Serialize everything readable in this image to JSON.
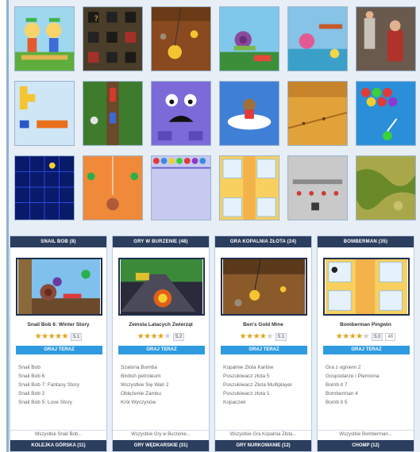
{
  "thumbnails": [
    {
      "name": "thumb-game-1",
      "icon": "two-kids-game"
    },
    {
      "name": "thumb-game-2",
      "icon": "dark-maze-game"
    },
    {
      "name": "thumb-game-3",
      "icon": "gold-mine-game"
    },
    {
      "name": "thumb-game-4",
      "icon": "snail-level-game"
    },
    {
      "name": "thumb-game-5",
      "icon": "snail-dream-game"
    },
    {
      "name": "thumb-game-6",
      "icon": "street-fight-game"
    },
    {
      "name": "thumb-game-7",
      "icon": "tetris-blocks-game"
    },
    {
      "name": "thumb-game-8",
      "icon": "train-track-game"
    },
    {
      "name": "thumb-game-9",
      "icon": "purple-face-game"
    },
    {
      "name": "thumb-game-10",
      "icon": "cloud-rider-game"
    },
    {
      "name": "thumb-game-11",
      "icon": "golden-field-game"
    },
    {
      "name": "thumb-game-12",
      "icon": "bubble-shooter-game"
    },
    {
      "name": "thumb-game-13",
      "icon": "blue-grid-game"
    },
    {
      "name": "thumb-game-14",
      "icon": "orange-sky-game"
    },
    {
      "name": "thumb-game-15",
      "icon": "bubble-wall-game"
    },
    {
      "name": "thumb-game-16",
      "icon": "ice-blocks-game"
    },
    {
      "name": "thumb-game-17",
      "icon": "bomber-arena-game"
    },
    {
      "name": "thumb-game-18",
      "icon": "camo-map-game"
    }
  ],
  "categories": [
    {
      "header": "SNAIL BOB (8)",
      "featured_title": "Snail Bob 6: Winter Story",
      "stars": "★★★★★",
      "stars_off": "",
      "score": "5.1",
      "extra": "",
      "play": "GRAJ TERAZ",
      "games": [
        "Snail Bob",
        "Snail Bob 6",
        "Snail Bob 7: Fantasy Story",
        "Snail Bob 2",
        "Snail Bob 5: Love Story"
      ],
      "more": "Wszystkie Snail Bob...",
      "footer": "KOLEJKA GÓRSKA (11)"
    },
    {
      "header": "GRY W BURZENIE (48)",
      "featured_title": "Zemsta Latacych Zwierząt",
      "stars": "★★★★",
      "stars_off": "★",
      "score": "5.2",
      "extra": "",
      "play": "GRAJ TERAZ",
      "games": [
        "Szalona Bomba",
        "Birdish petroleum",
        "Wszystkie Się Walí 2",
        "Oblężenie Zamku",
        "Król Wyczynów"
      ],
      "more": "Wszystkie Gry w Burzenie...",
      "footer": "GRY WĘDKARSKIE (31)"
    },
    {
      "header": "GRA KOPALNIA ZŁOTA (24)",
      "featured_title": "Ben's Gold Mine",
      "stars": "★★★★",
      "stars_off": "★",
      "score": "5.1",
      "extra": "",
      "play": "GRAJ TERAZ",
      "games": [
        "Kopalnie Złota Karlów",
        "Poszukiwacz złota 5",
        "Poszukiwacz Złota Multiplayer",
        "Poszukiwacz złota 1",
        "Kopaczek"
      ],
      "more": "Wszystkie Gra Kopalnia Złota...",
      "footer": "GRY NURKOWANIE (12)"
    },
    {
      "header": "BOMBERMAN (35)",
      "featured_title": "Bomberman Pingwin",
      "stars": "★★★★",
      "stars_off": "★",
      "score": "5.0",
      "extra": "46",
      "play": "GRAJ TERAZ",
      "games": [
        "Gra z ogniem 2",
        "Gospodarze i Plemiona",
        "Bomb it 7",
        "Bomberman 4",
        "Bomb it 5"
      ],
      "more": "Wszystkie Bomberman...",
      "footer": "CHOMP (12)"
    }
  ],
  "colors": {
    "header_bg": "#2c3e5e",
    "play_button": "#2e9be0",
    "star": "#e6a21b",
    "frame_bg": "#e7eef6"
  }
}
